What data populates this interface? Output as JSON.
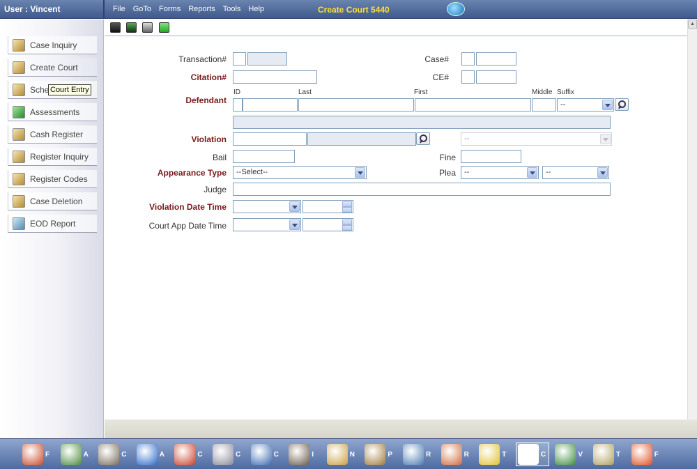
{
  "header": {
    "user": "User : Vincent",
    "menu": [
      "File",
      "GoTo",
      "Forms",
      "Reports",
      "Tools",
      "Help"
    ],
    "title": "Create Court  5440",
    "logo_icon": "globe-logo-icon"
  },
  "sidebar": {
    "items": [
      {
        "label": "Case Inquiry",
        "icon": "case-inquiry-icon"
      },
      {
        "label": "Create Court",
        "icon": "courthouse-icon"
      },
      {
        "label": "Sche",
        "icon": "schedule-icon"
      },
      {
        "label": "Assessments",
        "icon": "dollar-icon"
      },
      {
        "label": "Cash Register",
        "icon": "cash-register-icon"
      },
      {
        "label": "Register Inquiry",
        "icon": "register-inquiry-icon"
      },
      {
        "label": "Register Codes",
        "icon": "register-codes-icon"
      },
      {
        "label": "Case Deletion",
        "icon": "case-deletion-icon"
      },
      {
        "label": "EOD Report",
        "icon": "report-icon"
      }
    ],
    "tooltip": "Court Entry"
  },
  "toolbar": {
    "icons": [
      "save-icon",
      "save-as-icon",
      "print-icon",
      "refresh-icon"
    ]
  },
  "form": {
    "transaction_label": "Transaction#",
    "case_label": "Case#",
    "citation_label": "Citation#",
    "ce_label": "CE#",
    "defendant_label": "Defendant",
    "id_label": "ID",
    "last_label": "Last",
    "first_label": "First",
    "middle_label": "Middle",
    "suffix_label": "Suffix",
    "suffix_value": "--",
    "violation_label": "Violation",
    "violation_select_value": "--",
    "bail_label": "Bail",
    "fine_label": "Fine",
    "appearance_type_label": "Appearance Type",
    "appearance_type_value": "--Select--",
    "plea_label": "Plea",
    "plea_value_1": "--",
    "plea_value_2": "--",
    "judge_label": "Judge",
    "violation_date_time_label": "Violation Date Time",
    "court_app_date_time_label": "Court App Date Time"
  },
  "taskbar": {
    "items": [
      {
        "icon": "home-icon",
        "label": "F"
      },
      {
        "icon": "computer-icon",
        "label": "A"
      },
      {
        "icon": "officer-icon",
        "label": "C"
      },
      {
        "icon": "lightning-icon",
        "label": "A"
      },
      {
        "icon": "headset-icon",
        "label": "C"
      },
      {
        "icon": "clipboard-icon",
        "label": "C"
      },
      {
        "icon": "magnifier-icon",
        "label": "C"
      },
      {
        "icon": "prisoner-icon",
        "label": "I"
      },
      {
        "icon": "id-card-icon",
        "label": "N"
      },
      {
        "icon": "house-money-icon",
        "label": "P"
      },
      {
        "icon": "map-icon",
        "label": "R"
      },
      {
        "icon": "car-icon",
        "label": "R"
      },
      {
        "icon": "road-sign-icon",
        "label": "T"
      },
      {
        "icon": "courthouse-icon",
        "label": "C"
      },
      {
        "icon": "money-icon",
        "label": "V"
      },
      {
        "icon": "badge-icon",
        "label": "T"
      },
      {
        "icon": "fire-icon",
        "label": "F"
      }
    ],
    "colors": [
      "#c94a2a",
      "#4a8a3a",
      "#7a6a5a",
      "#2a6ac9",
      "#c9402a",
      "#8a8a9a",
      "#3a6ab0",
      "#6a5a4a",
      "#c9a040",
      "#a07a3a",
      "#4a7ab0",
      "#d06a3a",
      "#e0c030",
      "#ffffff",
      "#3a8a3a",
      "#b0a060",
      "#e05020"
    ]
  }
}
